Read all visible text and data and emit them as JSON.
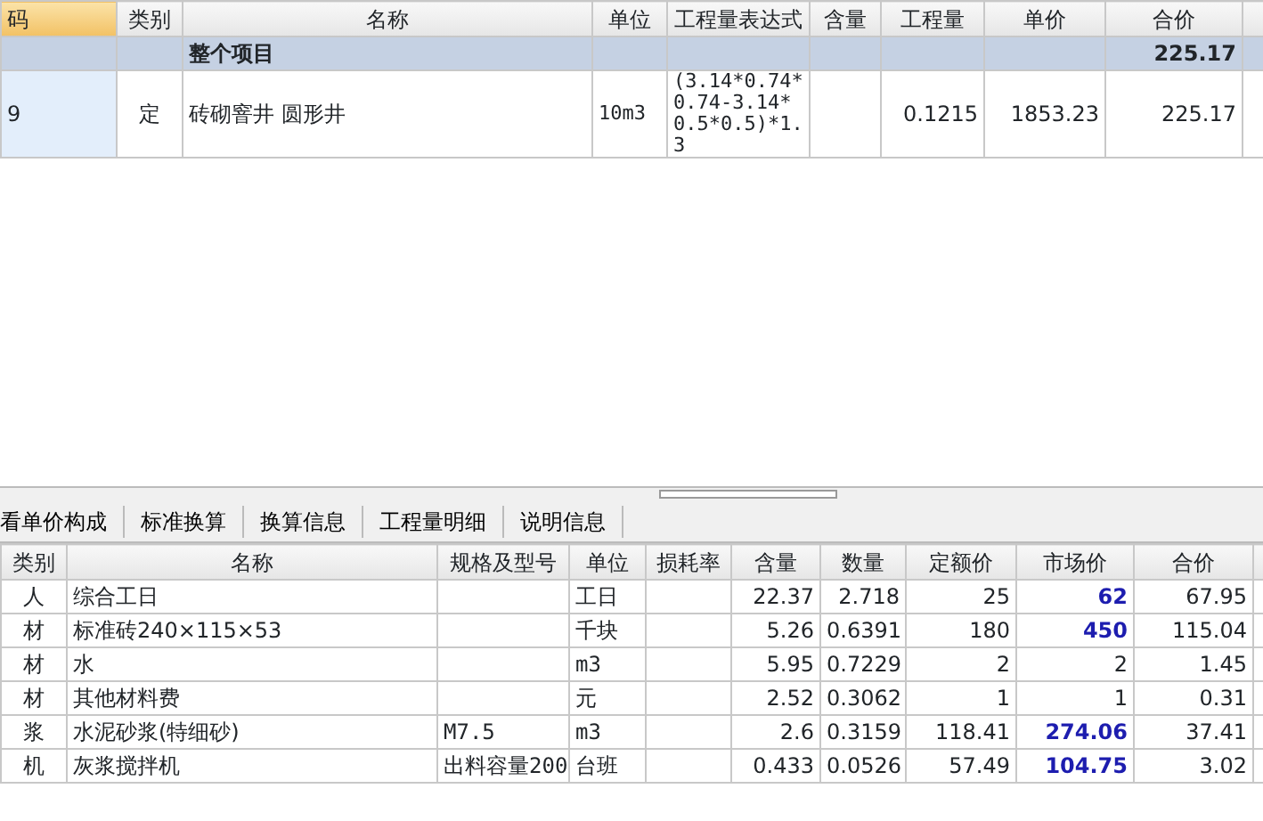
{
  "quota_table": {
    "columns": [
      {
        "label": "码",
        "selected": true
      },
      {
        "label": "类别",
        "selected": false
      },
      {
        "label": "名称",
        "selected": false
      },
      {
        "label": "单位",
        "selected": false
      },
      {
        "label": "工程量表达式",
        "selected": false
      },
      {
        "label": "含量",
        "selected": false
      },
      {
        "label": "工程量",
        "selected": false
      },
      {
        "label": "单价",
        "selected": false
      },
      {
        "label": "合价",
        "selected": false
      }
    ],
    "rows": [
      {
        "kind": "group",
        "cells": [
          "",
          "",
          "整个项目",
          "",
          "",
          "",
          "",
          "",
          "225.17"
        ]
      },
      {
        "kind": "item",
        "cells": [
          "9",
          "定",
          "砖砌窨井 圆形井",
          "10m3",
          "(3.14*0.74*0.74-3.14*0.5*0.5)*1.3",
          "",
          "0.1215",
          "1853.23",
          "225.17"
        ]
      }
    ]
  },
  "tabs": [
    {
      "label": "看单价构成",
      "selected": false
    },
    {
      "label": "标准换算",
      "selected": false
    },
    {
      "label": "换算信息",
      "selected": false
    },
    {
      "label": "工程量明细",
      "selected": false
    },
    {
      "label": "说明信息",
      "selected": false
    }
  ],
  "resource_table": {
    "columns": [
      "类别",
      "名称",
      "规格及型号",
      "单位",
      "损耗率",
      "含量",
      "数量",
      "定额价",
      "市场价",
      "合价"
    ],
    "rows": [
      {
        "cells": [
          "人",
          "综合工日",
          "",
          "工日",
          "",
          "22.37",
          "2.718",
          "25",
          "62",
          "67.95"
        ],
        "price_changed": true
      },
      {
        "cells": [
          "材",
          "标准砖240×115×53",
          "",
          "千块",
          "",
          "5.26",
          "0.6391",
          "180",
          "450",
          "115.04"
        ],
        "price_changed": true
      },
      {
        "cells": [
          "材",
          "水",
          "",
          "m3",
          "",
          "5.95",
          "0.7229",
          "2",
          "2",
          "1.45"
        ],
        "price_changed": false
      },
      {
        "cells": [
          "材",
          "其他材料费",
          "",
          "元",
          "",
          "2.52",
          "0.3062",
          "1",
          "1",
          "0.31"
        ],
        "price_changed": false
      },
      {
        "cells": [
          "浆",
          "水泥砂浆(特细砂)",
          "M7.5",
          "m3",
          "",
          "2.6",
          "0.3159",
          "118.41",
          "274.06",
          "37.41"
        ],
        "price_changed": true
      },
      {
        "cells": [
          "机",
          "灰浆搅拌机",
          "出料容量200",
          "台班",
          "",
          "0.433",
          "0.0526",
          "57.49",
          "104.75",
          "3.02"
        ],
        "price_changed": true
      }
    ]
  }
}
